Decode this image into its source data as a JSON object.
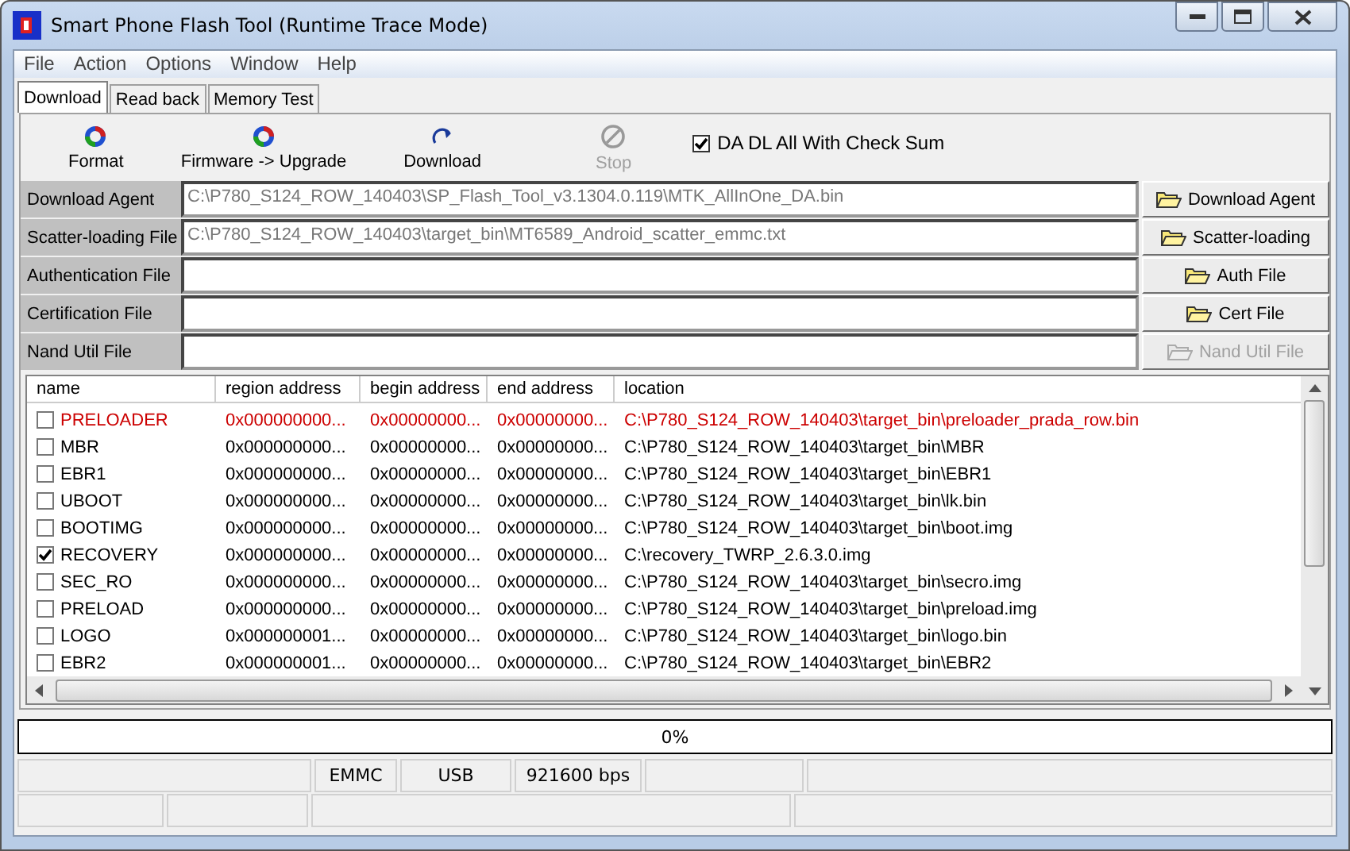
{
  "window": {
    "title": "Smart Phone Flash Tool (Runtime Trace Mode)"
  },
  "menu": [
    "File",
    "Action",
    "Options",
    "Window",
    "Help"
  ],
  "tabs": [
    {
      "label": "Download",
      "selected": true
    },
    {
      "label": "Read back",
      "selected": false
    },
    {
      "label": "Memory Test",
      "selected": false
    }
  ],
  "toolbar": [
    {
      "label": "Format",
      "kind": "format",
      "disabled": false
    },
    {
      "label": "Firmware -> Upgrade",
      "kind": "format",
      "disabled": false
    },
    {
      "label": "Download",
      "kind": "download",
      "disabled": false
    },
    {
      "label": "Stop",
      "kind": "stop",
      "disabled": true
    }
  ],
  "checksum": {
    "label": "DA DL All With Check Sum",
    "checked": true
  },
  "files": [
    {
      "label": "Download Agent",
      "value": "C:\\P780_S124_ROW_140403\\SP_Flash_Tool_v3.1304.0.119\\MTK_AllInOne_DA.bin",
      "button": "Download Agent",
      "disabled": false
    },
    {
      "label": "Scatter-loading File",
      "value": "C:\\P780_S124_ROW_140403\\target_bin\\MT6589_Android_scatter_emmc.txt",
      "button": "Scatter-loading",
      "disabled": false
    },
    {
      "label": "Authentication File",
      "button": "Auth File",
      "disabled": false
    },
    {
      "label": "Certification File",
      "button": "Cert File",
      "disabled": false
    },
    {
      "label": "Nand Util File",
      "button": "Nand Util File",
      "disabled": true
    }
  ],
  "table": {
    "columns": [
      "name",
      "region address",
      "begin address",
      "end address",
      "location"
    ],
    "rows": [
      {
        "checked": false,
        "color": "#cc0000",
        "cells": [
          "PRELOADER",
          "0x000000000...",
          "0x00000000...",
          "0x00000000...",
          "C:\\P780_S124_ROW_140403\\target_bin\\preloader_prada_row.bin"
        ]
      },
      {
        "checked": false,
        "color": "#000000",
        "cells": [
          "MBR",
          "0x000000000...",
          "0x00000000...",
          "0x00000000...",
          "C:\\P780_S124_ROW_140403\\target_bin\\MBR"
        ]
      },
      {
        "checked": false,
        "color": "#000000",
        "cells": [
          "EBR1",
          "0x000000000...",
          "0x00000000...",
          "0x00000000...",
          "C:\\P780_S124_ROW_140403\\target_bin\\EBR1"
        ]
      },
      {
        "checked": false,
        "color": "#000000",
        "cells": [
          "UBOOT",
          "0x000000000...",
          "0x00000000...",
          "0x00000000...",
          "C:\\P780_S124_ROW_140403\\target_bin\\lk.bin"
        ]
      },
      {
        "checked": false,
        "color": "#000000",
        "cells": [
          "BOOTIMG",
          "0x000000000...",
          "0x00000000...",
          "0x00000000...",
          "C:\\P780_S124_ROW_140403\\target_bin\\boot.img"
        ]
      },
      {
        "checked": true,
        "color": "#000000",
        "cells": [
          "RECOVERY",
          "0x000000000...",
          "0x00000000...",
          "0x00000000...",
          "C:\\recovery_TWRP_2.6.3.0.img"
        ]
      },
      {
        "checked": false,
        "color": "#000000",
        "cells": [
          "SEC_RO",
          "0x000000000...",
          "0x00000000...",
          "0x00000000...",
          "C:\\P780_S124_ROW_140403\\target_bin\\secro.img"
        ]
      },
      {
        "checked": false,
        "color": "#000000",
        "cells": [
          "PRELOAD",
          "0x000000000...",
          "0x00000000...",
          "0x00000000...",
          "C:\\P780_S124_ROW_140403\\target_bin\\preload.img"
        ]
      },
      {
        "checked": false,
        "color": "#000000",
        "cells": [
          "LOGO",
          "0x000000001...",
          "0x00000000...",
          "0x00000000...",
          "C:\\P780_S124_ROW_140403\\target_bin\\logo.bin"
        ]
      },
      {
        "checked": false,
        "color": "#000000",
        "cells": [
          "EBR2",
          "0x000000001...",
          "0x00000000...",
          "0x00000000...",
          "C:\\P780_S124_ROW_140403\\target_bin\\EBR2"
        ]
      }
    ]
  },
  "progress": {
    "label": "0%",
    "level": 0
  },
  "status_bar": {
    "row_1": [
      "EMMC",
      "USB",
      "921600 bps"
    ]
  }
}
